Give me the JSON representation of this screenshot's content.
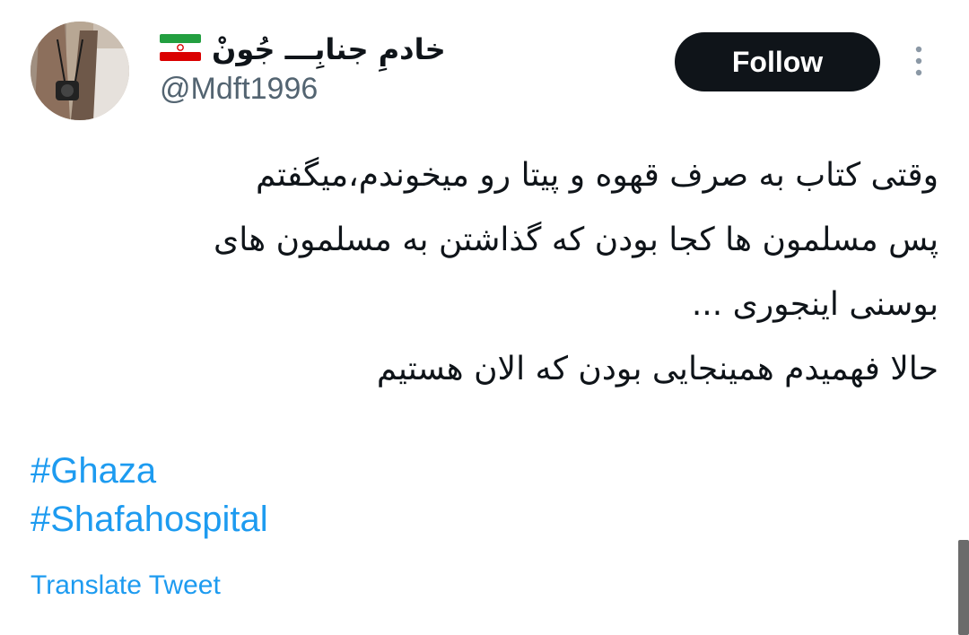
{
  "author": {
    "display_name": "خادمِ جنابِـــ جُونْ",
    "handle": "@Mdft1996",
    "flag_icon": "iran-flag-icon",
    "avatar_icon": "profile-photo"
  },
  "follow_button": {
    "label": "Follow"
  },
  "more_menu": {
    "icon": "more-vertical-icon"
  },
  "tweet": {
    "lines": [
      "وقتی کتاب به صرف قهوه و پیتا رو میخوندم،میگفتم",
      "پس مسلمون ها کجا بودن که گذاشتن به مسلمون های",
      "بوسنی اینجوری ...",
      "حالا فهمیدم همینجایی بودن که الان هستیم"
    ]
  },
  "hashtags": [
    "#Ghaza",
    "#Shafahospital"
  ],
  "translate_link": {
    "label": "Translate Tweet"
  },
  "colors": {
    "link": "#1d9bf0",
    "text": "#0f1419",
    "secondary": "#536471",
    "button_bg": "#0f1419"
  }
}
